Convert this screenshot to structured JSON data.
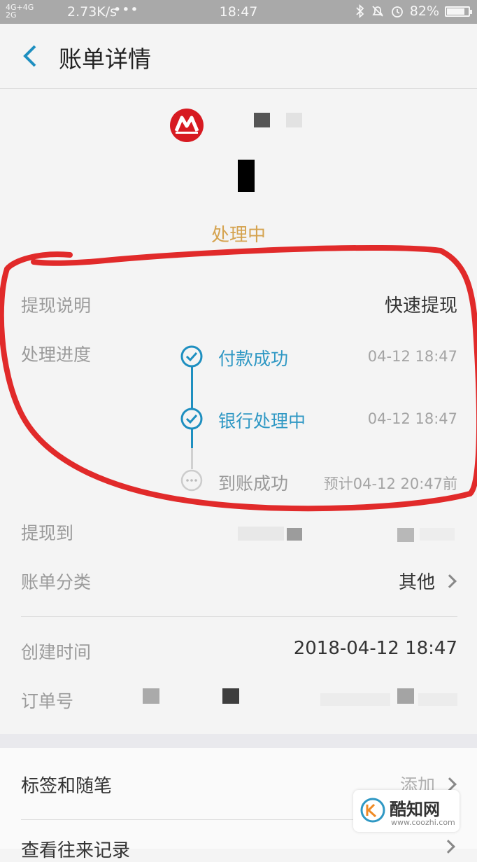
{
  "statusbar": {
    "network_top": "4G+4G",
    "network_bottom": "2G",
    "speed": "2.73K/s",
    "dots": "•••",
    "time": "18:47",
    "battery": "82%",
    "battery_level": 0.82
  },
  "header": {
    "title": "账单详情",
    "back_icon": "chevron-left-icon"
  },
  "bill": {
    "bank_logo_icon": "china-merchants-bank-logo",
    "status": "处理中"
  },
  "details": {
    "withdraw_desc_label": "提现说明",
    "withdraw_desc_value": "快速提现",
    "progress_label": "处理进度",
    "steps": [
      {
        "name": "付款成功",
        "time": "04-12 18:47",
        "state": "done"
      },
      {
        "name": "银行处理中",
        "time": "04-12 18:47",
        "state": "done"
      },
      {
        "name": "到账成功",
        "time": "预计04-12 20:47前",
        "state": "pending"
      }
    ],
    "withdraw_to_label": "提现到",
    "category_label": "账单分类",
    "category_value": "其他",
    "created_label": "创建时间",
    "created_value": "2018-04-12 18:47",
    "order_label": "订单号"
  },
  "extras": {
    "tags_label": "标签和随笔",
    "tags_action": "添加",
    "records_label": "查看往来记录"
  },
  "watermark": {
    "name": "酷知网",
    "url": "www.coozhi.com"
  },
  "colors": {
    "accent_blue": "#1e8fc0",
    "status_gold": "#d5a34f",
    "annotation_red": "#e12a2a"
  }
}
